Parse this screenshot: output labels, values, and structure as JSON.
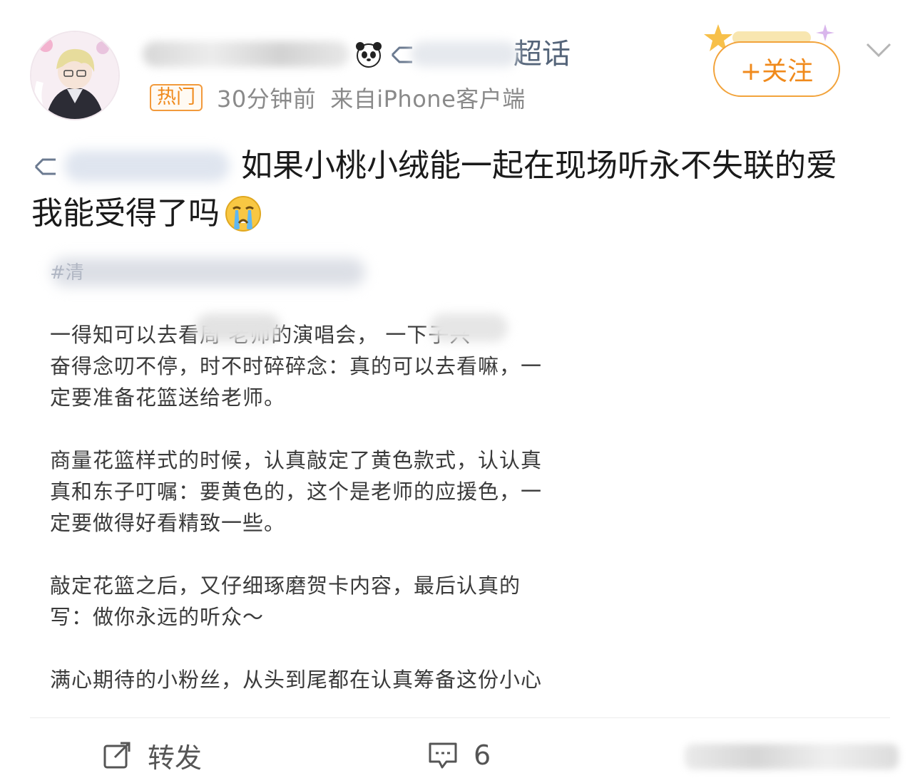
{
  "header": {
    "super_topic_label": "超话",
    "hot_badge": "热门",
    "time_ago": "30分钟前",
    "source": "来自iPhone客户端",
    "follow_label": "+关注"
  },
  "post": {
    "line1_text": "如果小桃小绒能一起在现场听永不失联的爱",
    "line2_text": "我能受得了吗"
  },
  "image": {
    "top_hashtag_fragment": "#清",
    "paragraphs": [
      "一得知可以去看周    老师的演唱会，        一下子兴",
      "奋得念叨不停，时不时碎碎念：真的可以去看嘛，一",
      "定要准备花篮送给老师。",
      "商量花篮样式的时候，认真敲定了黄色款式，认认真",
      "真和东子叮嘱：要黄色的，这个是老师的应援色，一",
      "定要做得好看精致一些。",
      "敲定花篮之后，又仔细琢磨贺卡内容，最后认真的",
      "写：做你永远的听众～",
      "满心期待的小粉丝，从头到尾都在认真筹备这份小心"
    ]
  },
  "actions": {
    "repost_label": "转发",
    "comment_count": "6"
  },
  "colors": {
    "accent_orange": "#f08a1c",
    "topic_gray_blue": "#55657a"
  }
}
